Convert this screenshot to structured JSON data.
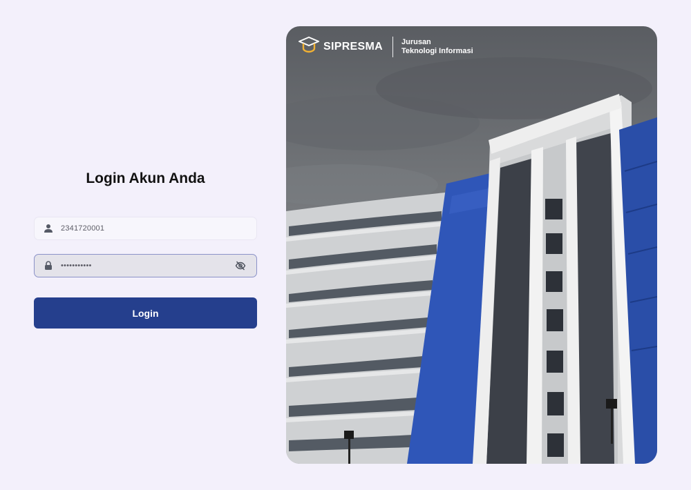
{
  "login": {
    "title": "Login Akun Anda",
    "username_value": "2341720001",
    "password_value": "•••••••••••",
    "submit_label": "Login",
    "username_icon": "user-icon",
    "password_icon": "lock-icon",
    "toggle_icon": "eye-off-icon"
  },
  "brand": {
    "name": "SIPRESMA",
    "dept_line1": "Jurusan",
    "dept_line2": "Teknologi Informasi",
    "logo_icon": "graduation-cap-icon"
  },
  "colors": {
    "background": "#f3f0fb",
    "primary": "#253f8d",
    "logo_accent": "#f2b233"
  }
}
